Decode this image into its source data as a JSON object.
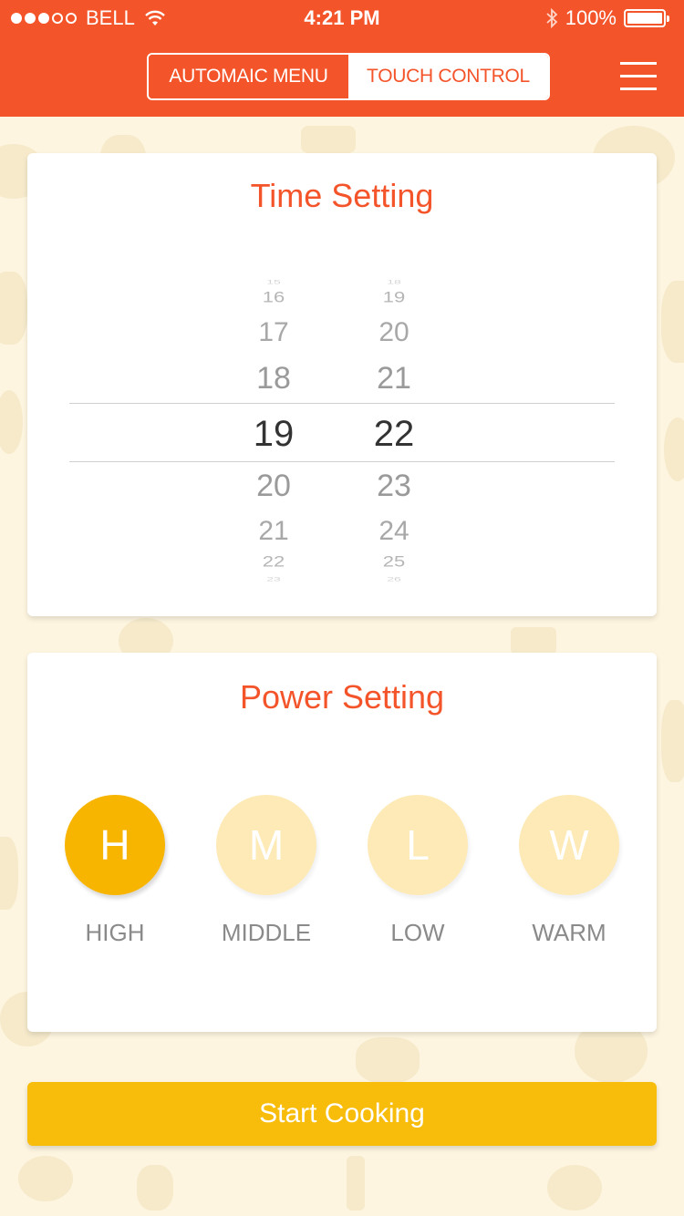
{
  "status_bar": {
    "carrier": "BELL",
    "time": "4:21 PM",
    "battery": "100%",
    "signal_strength": 3
  },
  "header": {
    "tabs": [
      {
        "label": "AUTOMAIC MENU",
        "active": true
      },
      {
        "label": "TOUCH CONTROL",
        "active": false
      }
    ],
    "menu_icon": "menu-list-icon"
  },
  "time_setting": {
    "title": "Time Setting",
    "hours": {
      "values": [
        "15",
        "16",
        "17",
        "18",
        "19",
        "20",
        "21",
        "22",
        "23"
      ],
      "selected": "19"
    },
    "minutes": {
      "values": [
        "18",
        "19",
        "20",
        "21",
        "22",
        "23",
        "24",
        "25",
        "26"
      ],
      "selected": "22"
    }
  },
  "power_setting": {
    "title": "Power Setting",
    "options": [
      {
        "letter": "H",
        "label": "HIGH",
        "selected": true
      },
      {
        "letter": "M",
        "label": "MIDDLE",
        "selected": false
      },
      {
        "letter": "L",
        "label": "LOW",
        "selected": false
      },
      {
        "letter": "W",
        "label": "WARM",
        "selected": false
      }
    ]
  },
  "start_button": {
    "label": "Start Cooking"
  },
  "colors": {
    "header": "#f4542a",
    "accent_title": "#f4542a",
    "power_selected": "#f8b500",
    "power_unselected": "#fdeab6",
    "start_button": "#f8bc0a",
    "background": "#fdf5df"
  }
}
